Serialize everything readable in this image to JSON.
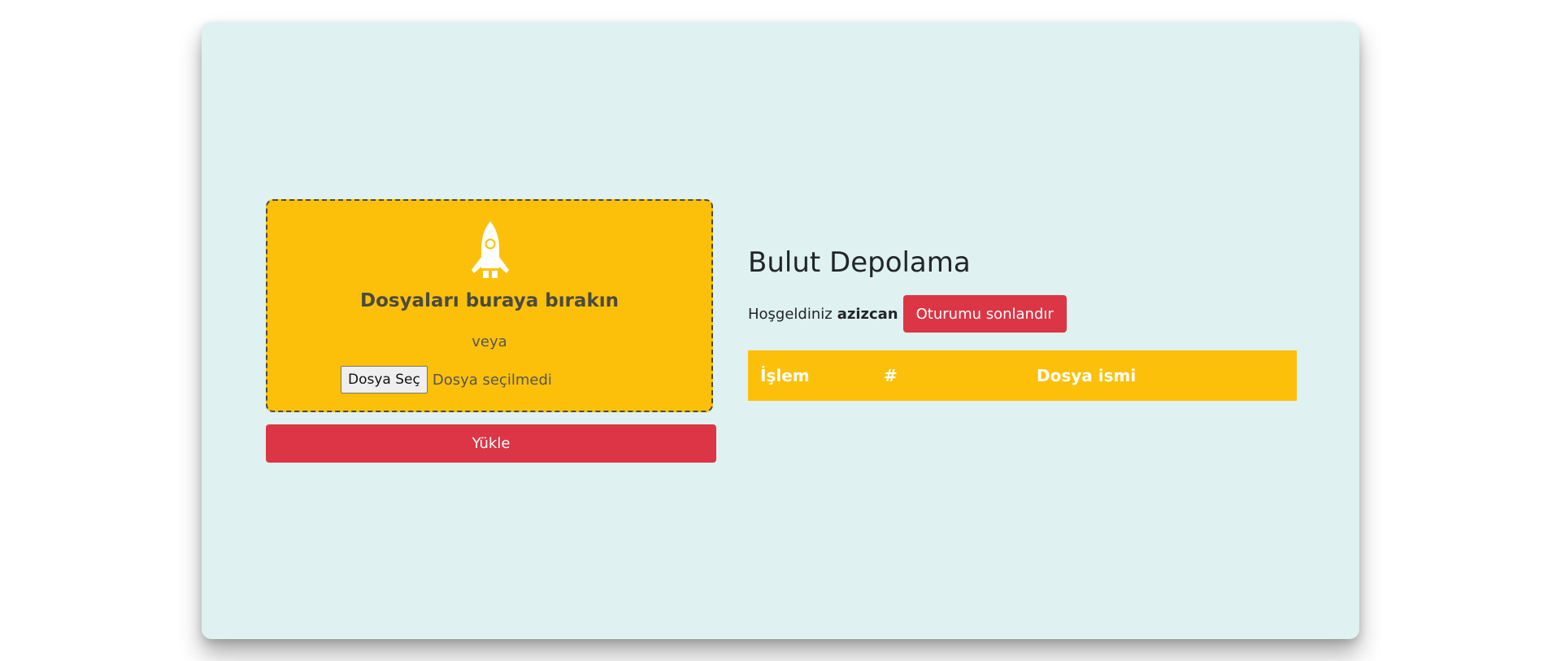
{
  "upload": {
    "drop_title": "Dosyaları buraya bırakın",
    "or_label": "veya",
    "file_button_label": "Dosya Seç",
    "file_status": "Dosya seçilmedi",
    "upload_button_label": "Yükle",
    "icon": "rocket-icon"
  },
  "header": {
    "title": "Bulut Depolama",
    "welcome_text": "Hoşgeldiniz",
    "username": "azizcan",
    "logout_label": "Oturumu sonlandır"
  },
  "table": {
    "columns": [
      "İşlem",
      "#",
      "Dosya ismi"
    ],
    "rows": []
  },
  "colors": {
    "card_background": "#dff1f1",
    "accent_yellow": "#fdc00a",
    "danger_red": "#dc3545"
  }
}
